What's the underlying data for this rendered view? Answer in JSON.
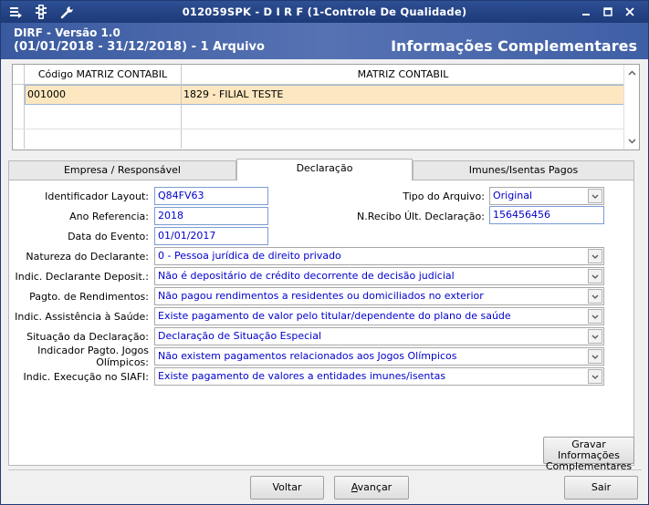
{
  "window": {
    "title": "012059SPK - D I R F (1-Controle De Qualidade)"
  },
  "header": {
    "line1": "DIRF - Versão 1.0",
    "line2": "(01/01/2018 - 31/12/2018) - 1 Arquivo",
    "section_title": "Informações Complementares"
  },
  "grid": {
    "columns": [
      "Código MATRIZ CONTABIL",
      "MATRIZ CONTABIL"
    ],
    "rows": [
      {
        "code": "001000",
        "name": "1829 - FILIAL TESTE"
      }
    ]
  },
  "tabs": [
    {
      "label": "Empresa / Responsável",
      "active": false
    },
    {
      "label": "Declaração",
      "active": true
    },
    {
      "label": "Imunes/Isentas Pagos",
      "active": false
    }
  ],
  "form": {
    "identificador_layout": {
      "label": "Identificador Layout:",
      "value": "Q84FV63"
    },
    "ano_referencia": {
      "label": "Ano Referencia:",
      "value": "2018"
    },
    "data_evento": {
      "label": "Data do Evento:",
      "value": "01/01/2017"
    },
    "tipo_arquivo": {
      "label": "Tipo do Arquivo:",
      "value": "Original"
    },
    "nrecibo": {
      "label": "N.Recibo Últ. Declaração:",
      "value": "156456456"
    },
    "natureza": {
      "label": "Natureza do Declarante:",
      "value": "0 - Pessoa jurídica de direito privado"
    },
    "indic_depositario": {
      "label": "Indic. Declarante Deposit.:",
      "value": "Não é depositário de crédito decorrente de decisão judicial"
    },
    "pagto_rendimentos": {
      "label": "Pagto. de Rendimentos:",
      "value": "Não pagou rendimentos a residentes ou domiciliados no exterior"
    },
    "assistencia_saude": {
      "label": "Indic. Assistência à Saúde:",
      "value": "Existe pagamento de valor pelo titular/dependente do plano de saúde"
    },
    "situacao": {
      "label": "Situação da Declaração:",
      "value": "Declaração de Situação Especial"
    },
    "jogos_olimpicos": {
      "label_1": "Indicador Pagto. Jogos",
      "label_2": "Olímpicos:",
      "value": "Não existem pagamentos relacionados aos Jogos Olímpicos"
    },
    "siafi": {
      "label": "Indic. Execução no SIAFI:",
      "value": "Existe pagamento de valores a entidades imunes/isentas"
    }
  },
  "buttons": {
    "gravar_line1": "Gravar Informações",
    "gravar_line2": "Complementares",
    "voltar": "Voltar",
    "avancar_prefix": "A",
    "avancar_rest": "vançar",
    "sair": "Sair"
  },
  "colors": {
    "titlebar": "#1d3a78",
    "header": "#4a68ab",
    "selected_row": "#fde7c0",
    "value_text": "#0000cc"
  },
  "icons": [
    "menu-icon",
    "traffic-light-icon",
    "wrench-icon",
    "minimize-icon",
    "maximize-icon",
    "close-icon"
  ]
}
